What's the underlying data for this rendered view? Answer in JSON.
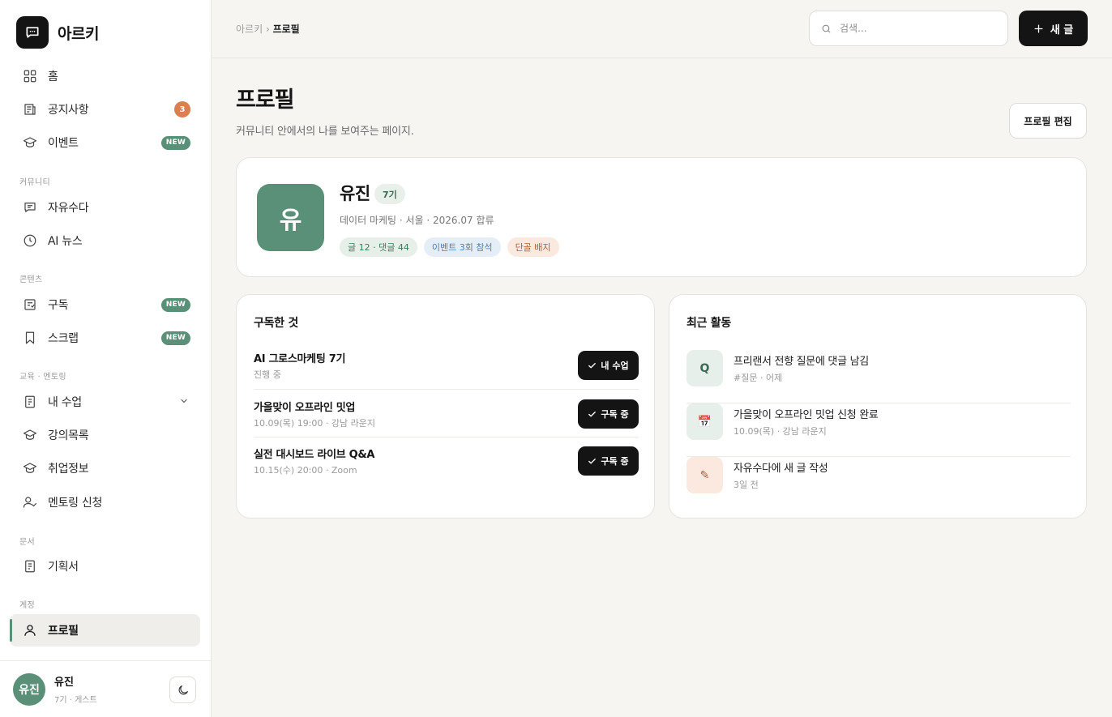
{
  "brand": {
    "name": "아르키"
  },
  "nav": {
    "home": "홈",
    "notice": "공지사항",
    "notice_count": "3",
    "events": "이벤트",
    "events_badge": "NEW",
    "section_community": "커뮤니티",
    "freetalk": "자유수다",
    "ainews": "AI 뉴스",
    "section_content": "콘텐츠",
    "subscribe": "구독",
    "subscribe_badge": "NEW",
    "scrap": "스크랩",
    "scrap_badge": "NEW",
    "section_edu": "교육 · 멘토링",
    "myclass": "내 수업",
    "courses": "강의목록",
    "jobs": "취업정보",
    "mentoring": "멘토링 신청",
    "section_docs": "문서",
    "proposal": "기획서",
    "section_account": "계정",
    "profile": "프로필"
  },
  "user": {
    "initial": "유진",
    "name": "유진",
    "meta": "7기 · 게스트"
  },
  "topbar": {
    "breadcrumb_root": "아르키",
    "breadcrumb_sep": " › ",
    "breadcrumb_current": "프로필",
    "search_placeholder": "검색...",
    "new_post": "새 글"
  },
  "page": {
    "title": "프로필",
    "subtitle": "커뮤니티 안에서의 나를 보여주는 페이지.",
    "edit_button": "프로필 편집"
  },
  "profile": {
    "avatar_initial": "유",
    "name": "유진",
    "generation": "7기",
    "meta": "데이터 마케팅 · 서울 · 2026.07 합류",
    "chips": [
      "글 12 · 댓글 44",
      "이벤트 3회 참석",
      "단골 배지"
    ]
  },
  "subscriptions": {
    "title": "구독한 것",
    "items": [
      {
        "name": "AI 그로스마케팅 7기",
        "meta": "진행 중",
        "button": "내 수업"
      },
      {
        "name": "가을맞이 오프라인 밋업",
        "meta": "10.09(목) 19:00 · 강남 라운지",
        "button": "구독 중"
      },
      {
        "name": "실전 대시보드 라이브 Q&A",
        "meta": "10.15(수) 20:00 · Zoom",
        "button": "구독 중"
      }
    ]
  },
  "activity": {
    "title": "최근 활동",
    "items": [
      {
        "icon": "Q",
        "title": "프리랜서 전향 질문에 댓글 남김",
        "meta": "#질문 · 어제"
      },
      {
        "icon": "📅",
        "title": "가을맞이 오프라인 밋업 신청 완료",
        "meta": "10.09(목) · 강남 라운지"
      },
      {
        "icon": "✎",
        "title": "자유수다에 새 글 작성",
        "meta": "3일 전"
      }
    ]
  },
  "colors": {
    "accent": "#5a8f78",
    "dark": "#141414",
    "count_badge": "#d97f52"
  }
}
